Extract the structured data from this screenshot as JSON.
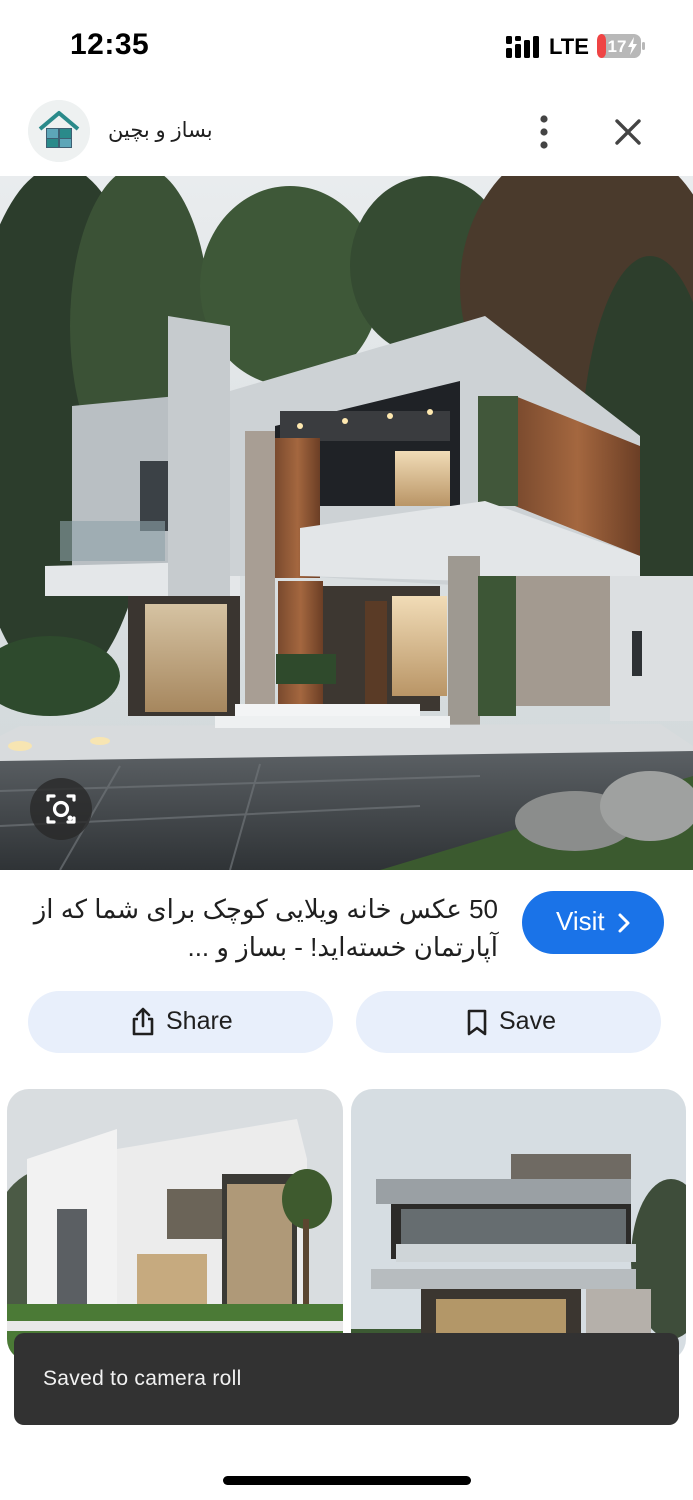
{
  "status_bar": {
    "time": "12:35",
    "network": "LTE",
    "battery_level": "17",
    "icons": [
      "signal-icon",
      "battery-charging-icon"
    ]
  },
  "header": {
    "site_name": "بساز و بچین",
    "icons": [
      "site-logo-icon",
      "more-vertical-icon",
      "close-icon"
    ]
  },
  "result": {
    "title": "50 عکس خانه ویلایی کوچک برای شما که از آپارتمان خسته‌اید! - بساز و ...",
    "visit_label": "Visit",
    "share_label": "Share",
    "save_label": "Save",
    "icons": [
      "lens-icon",
      "chevron-right-icon",
      "share-icon",
      "bookmark-icon"
    ]
  },
  "snackbar": {
    "message": "Saved to camera roll"
  },
  "colors": {
    "accent": "#1a73e8",
    "pill_bg": "#e8effb",
    "snackbar_bg": "#323232",
    "battery": "#ef4444"
  }
}
